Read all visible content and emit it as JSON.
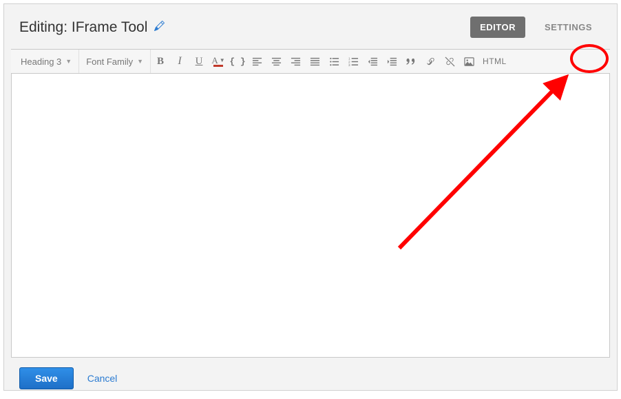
{
  "header": {
    "title": "Editing: IFrame Tool",
    "tabs": {
      "editor": "EDITOR",
      "settings": "SETTINGS"
    }
  },
  "toolbar": {
    "format_select": "Heading 3",
    "font_select": "Font Family",
    "bold": "B",
    "italic": "I",
    "underline": "U",
    "textcolor_a": "A",
    "code": "{ }",
    "quote": "❝",
    "html_label": "HTML"
  },
  "footer": {
    "save": "Save",
    "cancel": "Cancel"
  }
}
